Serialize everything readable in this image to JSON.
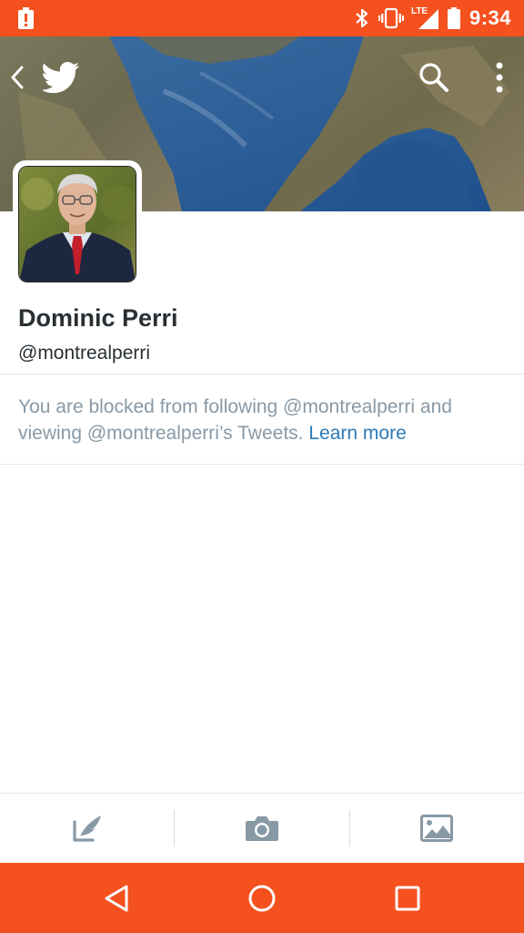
{
  "status_bar": {
    "time": "9:34",
    "network_label": "LTE",
    "icons": [
      "alert-icon",
      "bluetooth-icon",
      "vibrate-icon",
      "signal-icon",
      "battery-icon"
    ]
  },
  "header": {
    "icons": [
      "back-icon",
      "twitter-bird-icon",
      "search-icon",
      "overflow-menu-icon"
    ]
  },
  "profile": {
    "name": "Dominic Perri",
    "handle": "@montrealperri"
  },
  "blocked_notice": {
    "text": "You are blocked from following @montrealperri and viewing @montrealperri’s Tweets.",
    "link": "Learn more"
  },
  "compose_bar": {
    "icons": [
      "compose-tweet-icon",
      "camera-icon",
      "image-gallery-icon"
    ]
  },
  "nav_bar": {
    "icons": [
      "nav-back-icon",
      "nav-home-icon",
      "nav-recents-icon"
    ]
  },
  "colors": {
    "system_bars": "#f4511e",
    "link": "#2b7bb9",
    "muted_text": "#8899a6",
    "primary_text": "#292f33",
    "icon_gray": "#8899a6"
  }
}
